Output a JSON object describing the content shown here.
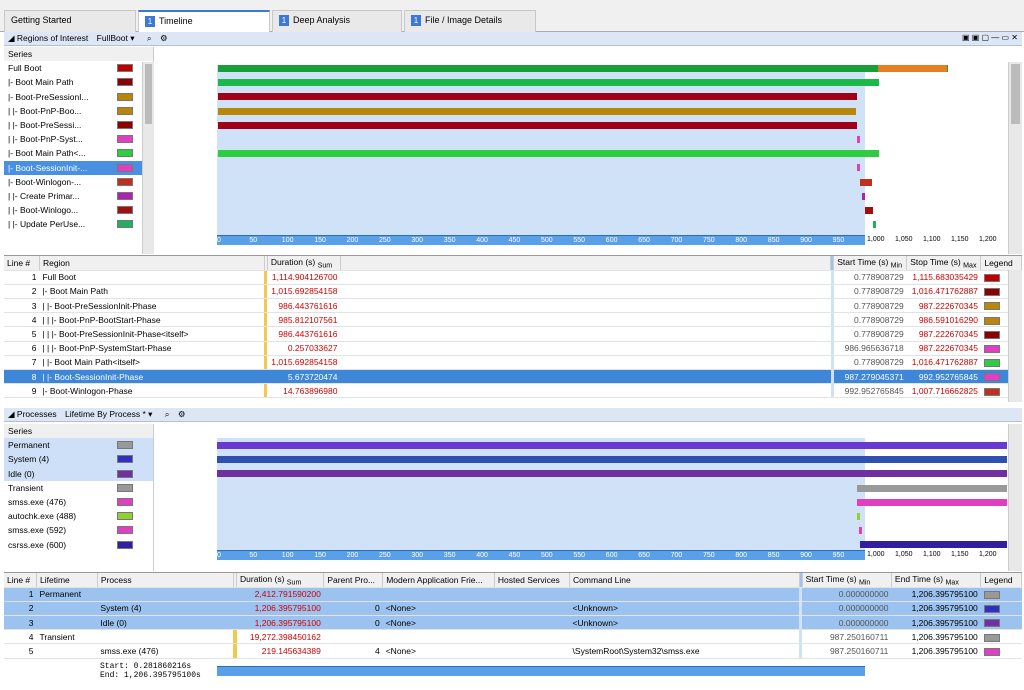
{
  "tabs": [
    {
      "label": "Getting Started",
      "num": ""
    },
    {
      "label": "Timeline",
      "num": "1"
    },
    {
      "label": "Deep Analysis",
      "num": "1"
    },
    {
      "label": "File / Image Details",
      "num": "1"
    }
  ],
  "roi": {
    "title": "Regions of Interest",
    "preset": "FullBoot",
    "series_header": "Series",
    "series": [
      {
        "label": "Full Boot",
        "color": "#c00000"
      },
      {
        "label": "|- Boot Main Path",
        "color": "#8b0000"
      },
      {
        "label": "|- Boot-PreSessionI...",
        "color": "#b8860b"
      },
      {
        "label": "| |- Boot-PnP-Boo...",
        "color": "#b8860b"
      },
      {
        "label": "| |- Boot-PreSessi...",
        "color": "#8b0000"
      },
      {
        "label": "| |- Boot-PnP-Syst...",
        "color": "#e040c0"
      },
      {
        "label": "|- Boot Main Path<...",
        "color": "#2ecc40"
      },
      {
        "label": "|- Boot-SessionInit-...",
        "color": "#e040c0"
      },
      {
        "label": "|- Boot-Winlogon-...",
        "color": "#c03020"
      },
      {
        "label": "| |- Create Primar...",
        "color": "#b020b0"
      },
      {
        "label": "| |- Boot-Winlogo...",
        "color": "#a01010"
      },
      {
        "label": "| |- Update PerUse...",
        "color": "#20b060"
      }
    ],
    "axis_ticks": [
      "0",
      "50",
      "100",
      "150",
      "200",
      "250",
      "300",
      "350",
      "400",
      "450",
      "500",
      "550",
      "600",
      "650",
      "700",
      "750",
      "800",
      "850",
      "900",
      "950"
    ],
    "zoom_ticks": [
      "1,000",
      "1,050",
      "1,100",
      "1,150",
      "1,200"
    ],
    "table": {
      "headers": [
        "Line #",
        "Region",
        "Duration (s)",
        "Sum",
        "Start Time (s)",
        "Min",
        "Stop Time (s)",
        "Max",
        "Legend"
      ],
      "rows": [
        {
          "line": "1",
          "region": "Full Boot",
          "dur": "1,114.904126700",
          "start": "0.778908729",
          "stop": "1,115.683035429",
          "color": "#c00000"
        },
        {
          "line": "2",
          "region": "|- Boot Main Path",
          "dur": "1,015.692854158",
          "start": "0.778908729",
          "stop": "1,016.471762887",
          "color": "#8b0000"
        },
        {
          "line": "3",
          "region": "|  |- Boot-PreSessionInit-Phase",
          "dur": "986.443761616",
          "start": "0.778908729",
          "stop": "987.222670345",
          "color": "#b8860b"
        },
        {
          "line": "4",
          "region": "|  |  |- Boot-PnP-BootStart-Phase",
          "dur": "985.812107561",
          "start": "0.778908729",
          "stop": "986.591016290",
          "color": "#b8860b"
        },
        {
          "line": "5",
          "region": "|  |  |- Boot-PreSessionInit-Phase<itself>",
          "dur": "986.443761616",
          "start": "0.778908729",
          "stop": "987.222670345",
          "color": "#8b0000"
        },
        {
          "line": "6",
          "region": "|  |  |- Boot-PnP-SystemStart-Phase",
          "dur": "0.257033627",
          "start": "986.965636718",
          "stop": "987.222670345",
          "color": "#e040c0"
        },
        {
          "line": "7",
          "region": "|  |- Boot Main Path<itself>",
          "dur": "1,015.692854158",
          "start": "0.778908729",
          "stop": "1,016.471762887",
          "color": "#2ecc40"
        },
        {
          "line": "8",
          "region": "|  |- Boot-SessionInit-Phase",
          "dur": "5.673720474",
          "start": "987.279045371",
          "stop": "992.952765845",
          "color": "#e040c0"
        },
        {
          "line": "9",
          "region": "|- Boot-Winlogon-Phase",
          "dur": "14.763896980",
          "start": "992.952765845",
          "stop": "1,007.716662825",
          "color": "#c03020"
        }
      ]
    }
  },
  "proc": {
    "title": "Processes",
    "preset": "Lifetime By Process *",
    "series_header": "Series",
    "series": [
      {
        "label": "Permanent",
        "color": "#999999"
      },
      {
        "label": "System (4)",
        "color": "#3030c0"
      },
      {
        "label": "Idle (0)",
        "color": "#7030a0"
      },
      {
        "label": "Transient",
        "color": "#999999"
      },
      {
        "label": "smss.exe (476)",
        "color": "#e040c0"
      },
      {
        "label": "autochk.exe (488)",
        "color": "#90d030"
      },
      {
        "label": "smss.exe (592)",
        "color": "#e040c0"
      },
      {
        "label": "csrss.exe (600)",
        "color": "#3020a0"
      }
    ],
    "table": {
      "headers": [
        "Line #",
        "Lifetime",
        "Process",
        "Duration (s)",
        "Sum",
        "Parent Pro...",
        "Modern Application Frie...",
        "Hosted Services",
        "Command Line",
        "Start Time (s)",
        "Min",
        "End Time (s)",
        "Max",
        "Legend"
      ],
      "rows": [
        {
          "line": "1",
          "life": "Permanent",
          "proc": "",
          "dur": "2,412.791590200",
          "parent": "",
          "modern": "",
          "hosted": "",
          "cmd": "",
          "start": "0.000000000",
          "end": "1,206.395795100",
          "color": "#999999"
        },
        {
          "line": "2",
          "life": "",
          "proc": "System (4)",
          "dur": "1,206.395795100",
          "parent": "0",
          "modern": "<None>",
          "hosted": "",
          "cmd": "<Unknown>",
          "start": "0.000000000",
          "end": "1,206.395795100",
          "color": "#3030c0"
        },
        {
          "line": "3",
          "life": "",
          "proc": "Idle (0)",
          "dur": "1,206.395795100",
          "parent": "0",
          "modern": "<None>",
          "hosted": "",
          "cmd": "<Unknown>",
          "start": "0.000000000",
          "end": "1,206.395795100",
          "color": "#7030a0"
        },
        {
          "line": "4",
          "life": "Transient",
          "proc": "",
          "dur": "19,272.398450162",
          "parent": "",
          "modern": "",
          "hosted": "",
          "cmd": "",
          "start": "987.250160711",
          "end": "1,206.395795100",
          "color": "#999999"
        },
        {
          "line": "5",
          "life": "",
          "proc": "smss.exe (476)",
          "dur": "219.145634389",
          "parent": "4",
          "modern": "<None>",
          "hosted": "",
          "cmd": "\\SystemRoot\\System32\\smss.exe",
          "start": "987.250160711",
          "end": "1,206.395795100",
          "color": "#e040c0"
        }
      ]
    }
  },
  "status": {
    "start": "Start:  0.281860216s",
    "end": "End: 1,206.395795100s"
  }
}
